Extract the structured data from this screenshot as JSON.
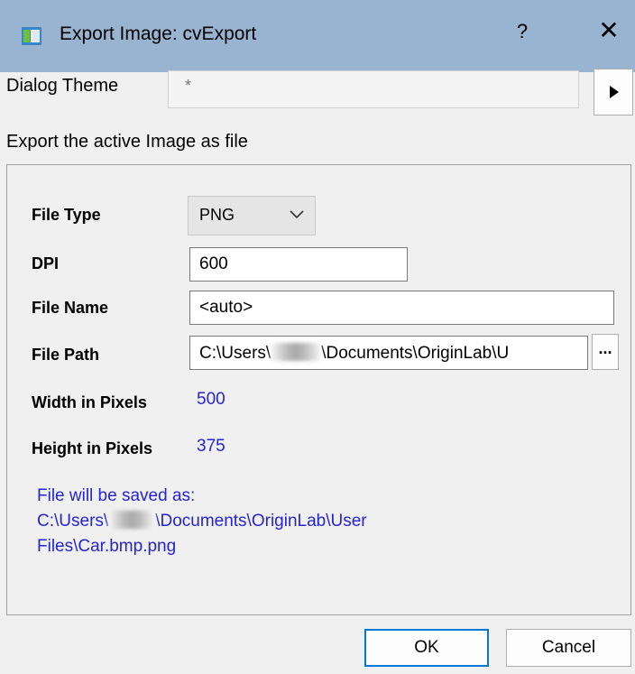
{
  "window": {
    "title": "Export Image: cvExport",
    "help_label": "?",
    "close_label": "✕"
  },
  "theme": {
    "label": "Dialog Theme",
    "value": "*",
    "arrow_icon": "play-icon"
  },
  "description": "Export the active Image as file",
  "form": {
    "file_type_label": "File Type",
    "file_type_value": "PNG",
    "dpi_label": "DPI",
    "dpi_value": "600",
    "file_name_label": "File Name",
    "file_name_value": "<auto>",
    "file_path_label": "File Path",
    "file_path_prefix": "C:\\Users\\",
    "file_path_suffix": "\\Documents\\OriginLab\\U",
    "browse_label": "...",
    "width_label": "Width in Pixels",
    "width_value": "500",
    "height_label": "Height in Pixels",
    "height_value": "375"
  },
  "saved_as": {
    "line1": "File will be saved as:",
    "line2_prefix": "C:\\Users\\",
    "line2_suffix": "\\Documents\\OriginLab\\User",
    "line3": "Files\\Car.bmp.png"
  },
  "buttons": {
    "ok": "OK",
    "cancel": "Cancel"
  },
  "colors": {
    "titlebar": "#99b4d1",
    "link_blue": "#2424d6",
    "focus_border": "#0078d7"
  }
}
